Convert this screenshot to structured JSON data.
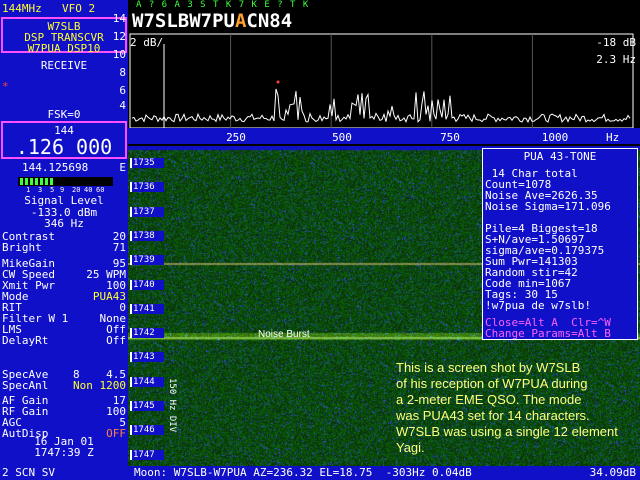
{
  "left": {
    "band": "144MHz",
    "vfo": "VFO 2",
    "info_lines": [
      "W7SLB",
      "DSP TRANSCVR",
      "W7PUA DSP10"
    ],
    "mode_state": "RECEIVE",
    "marker": "*",
    "fsk": "FSK=0",
    "freq_mhz": "144",
    "freq_khz": ".126 000",
    "freq_exact": "144.125698",
    "freq_exact_suffix": "E",
    "meter_scale": [
      "1",
      "3",
      "5",
      "9",
      "20",
      "40",
      "60"
    ],
    "signal_title": "Signal Level",
    "signal_dbm": "-133.0 dBm",
    "signal_hz": "346 Hz",
    "params": [
      {
        "label": "Contrast",
        "value": "20"
      },
      {
        "label": "Bright",
        "value": "71"
      },
      {
        "label": "MikeGain",
        "value": "95"
      },
      {
        "label": "CW Speed",
        "value": "25 WPM"
      },
      {
        "label": "Xmit Pwr",
        "value": "100"
      },
      {
        "label": "Mode",
        "value": "PUA43"
      },
      {
        "label": "RIT",
        "value": "0"
      },
      {
        "label": "Filter W 1",
        "value": "None"
      },
      {
        "label": "LMS",
        "value": "Off"
      },
      {
        "label": "DelayRt",
        "value": "Off"
      },
      {
        "label": "SpecAve",
        "value": "8    4.5"
      },
      {
        "label": "SpecAnl",
        "value": "Non 1200"
      },
      {
        "label": "AF Gain",
        "value": "17"
      },
      {
        "label": "RF Gain",
        "value": "100"
      },
      {
        "label": "AGC",
        "value": "5"
      },
      {
        "label": "AutDisp",
        "value": "OFF"
      }
    ],
    "date": "16 Jan 01",
    "time": "1747:39 Z",
    "bottom": "2     SCN  SV"
  },
  "spectrum": {
    "char_row": "A ? 6 A 3 S T K 7 K E ? T K",
    "decoded": [
      "W7SLBW7PU",
      "A",
      "CN84"
    ],
    "y_ticks": [
      "14",
      "12",
      "10",
      "8",
      "6",
      "4"
    ],
    "db_label": "2 dB/",
    "ref_db": "-18 dB",
    "span_hz": "2.3 Hz",
    "x_ticks": [
      "250",
      "500",
      "750",
      "1000"
    ],
    "x_unit": "Hz"
  },
  "waterfall": {
    "time_labels": [
      "1735",
      "1736",
      "1737",
      "1738",
      "1739",
      "1740",
      "1741",
      "1742",
      "1743",
      "1744",
      "1745",
      "1746",
      "1747"
    ],
    "noise_burst": "Noise Burst",
    "side_label": "150 Hz DIV"
  },
  "info": {
    "title": "PUA 43-TONE",
    "lines": [
      " 14 Char total",
      "Count=1078",
      "Noise Ave=2626.35",
      "Noise Sigma=171.096",
      "",
      "Pile=4 Biggest=18",
      "S+N/ave=1.50697",
      "sigma/ave=0.179375",
      "Sum Pwr=141303",
      "Random stir=42",
      "Code min=1067",
      "Tags: 30 15",
      "!w7pua de w7slb!"
    ],
    "footer1": "Close=Alt A  Clr=^W",
    "footer2": "Change Params=Alt B"
  },
  "caption": [
    "This is a screen shot by W7SLB",
    "of his reception of W7PUA during",
    "a 2-meter EME QSO. The mode",
    "was PUA43 set for 14 characters.",
    "W7SLB was using a single 12 element Yagi."
  ],
  "status": {
    "text": "Moon: W7SLB-W7PUA AZ=236.32 EL=18.75  -303Hz 0.04dB",
    "right": "34.09dB"
  },
  "colors": {
    "panel": "#1010c8",
    "cyan": "#50f0f0",
    "yellow": "#ffff30",
    "magenta": "#ff50ff",
    "waterfall": "#0c3a0c"
  }
}
